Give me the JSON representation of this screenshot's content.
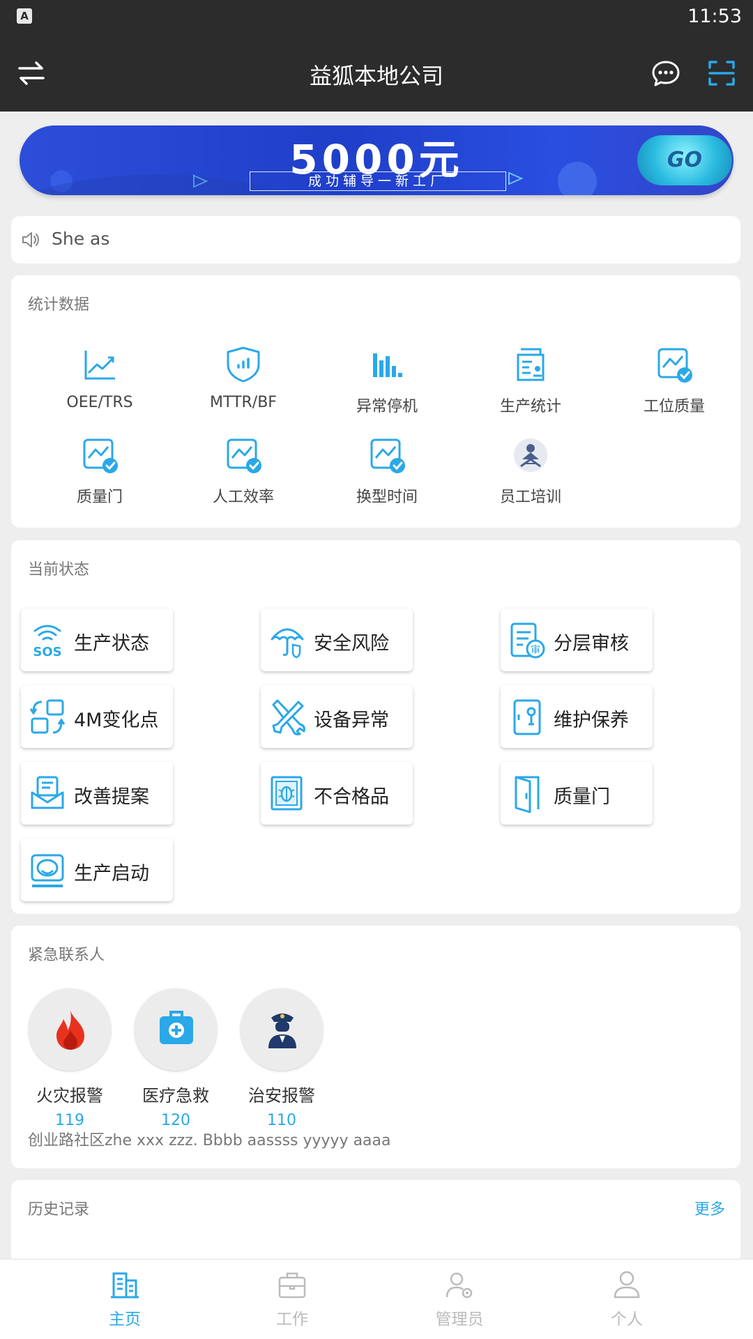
{
  "status_bar": {
    "time": "11:53",
    "notification": "A"
  },
  "app_bar": {
    "title": "益狐本地公司"
  },
  "banner": {
    "title": "5000元",
    "subtitle": "成功辅导一新工厂",
    "go_label": "GO"
  },
  "notice": {
    "text": "She as"
  },
  "stats": {
    "title": "统计数据",
    "items": [
      {
        "label": "OEE/TRS",
        "icon": "trend-chart-icon"
      },
      {
        "label": "MTTR/BF",
        "icon": "shield-chart-icon"
      },
      {
        "label": "异常停机",
        "icon": "bar-chart-icon"
      },
      {
        "label": "生产统计",
        "icon": "report-icon"
      },
      {
        "label": "工位质量",
        "icon": "quality-check-icon"
      },
      {
        "label": "质量门",
        "icon": "quality-check-icon"
      },
      {
        "label": "人工效率",
        "icon": "quality-check-icon"
      },
      {
        "label": "换型时间",
        "icon": "quality-check-icon"
      },
      {
        "label": "员工培训",
        "icon": "training-icon"
      }
    ]
  },
  "current_status": {
    "title": "当前状态",
    "tiles": [
      {
        "label": "生产状态",
        "icon": "sos-icon"
      },
      {
        "label": "安全风险",
        "icon": "umbrella-shield-icon"
      },
      {
        "label": "分层审核",
        "icon": "audit-icon"
      },
      {
        "label": "4M变化点",
        "icon": "change-point-icon"
      },
      {
        "label": "设备异常",
        "icon": "tools-icon"
      },
      {
        "label": "维护保养",
        "icon": "maintenance-icon"
      },
      {
        "label": "改善提案",
        "icon": "proposal-icon"
      },
      {
        "label": "不合格品",
        "icon": "defect-icon"
      },
      {
        "label": "质量门",
        "icon": "door-icon"
      },
      {
        "label": "生产启动",
        "icon": "production-start-icon"
      }
    ]
  },
  "emergency": {
    "title": "紧急联系人",
    "contacts": [
      {
        "name": "火灾报警",
        "number": "119",
        "icon": "fire-icon",
        "color": "#e8321e"
      },
      {
        "name": "医疗急救",
        "number": "120",
        "icon": "medical-kit-icon",
        "color": "#2aa8e8"
      },
      {
        "name": "治安报警",
        "number": "110",
        "icon": "police-icon",
        "color": "#1f3a6b"
      }
    ],
    "address": "创业路社区zhe xxx zzz. Bbbb aassss yyyyy aaaa"
  },
  "history": {
    "title": "历史记录",
    "more": "更多"
  },
  "bottom_nav": {
    "items": [
      {
        "label": "主页",
        "icon": "home-building-icon",
        "active": true
      },
      {
        "label": "工作",
        "icon": "briefcase-icon",
        "active": false
      },
      {
        "label": "管理员",
        "icon": "admin-icon",
        "active": false
      },
      {
        "label": "个人",
        "icon": "person-icon",
        "active": false
      }
    ]
  },
  "colors": {
    "accent": "#2aa8e8",
    "dark_bar": "#2c2c2c",
    "background": "#eeeeee"
  }
}
